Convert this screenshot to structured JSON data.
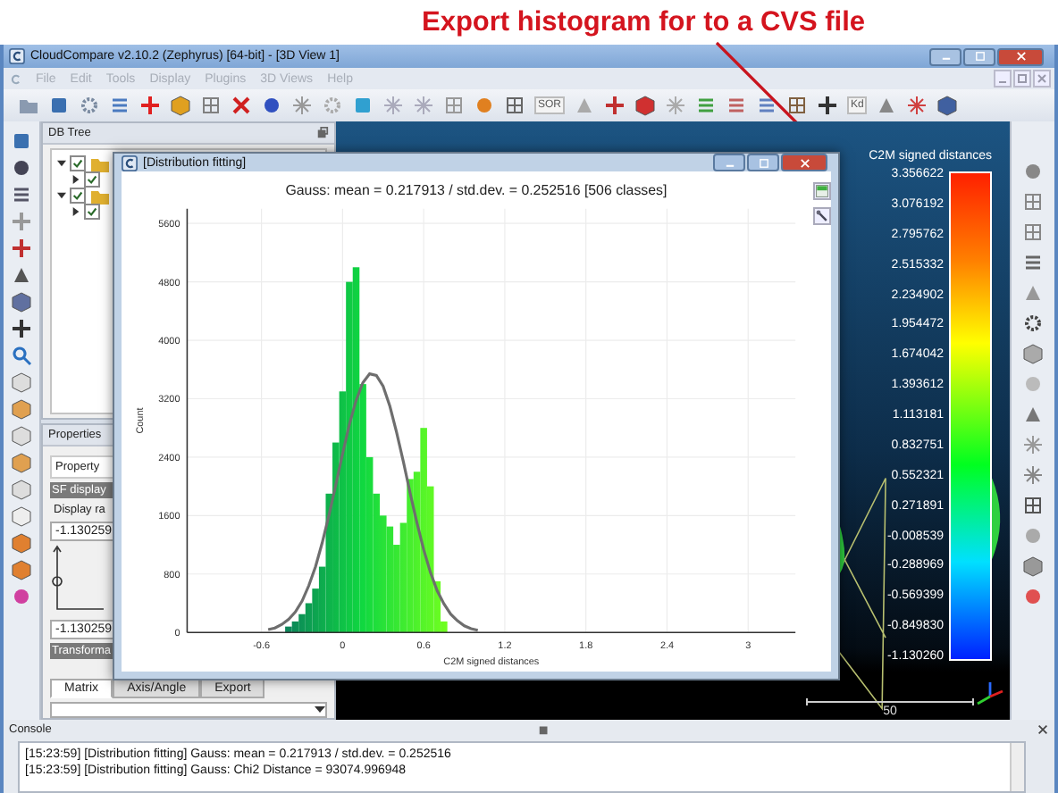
{
  "annotation": {
    "text": "Export histogram for to a CVS file"
  },
  "window": {
    "title": "CloudCompare v2.10.2 (Zephyrus) [64-bit] - [3D View 1]"
  },
  "menu": [
    {
      "label": "File",
      "disabled": true
    },
    {
      "label": "Edit",
      "disabled": true
    },
    {
      "label": "Tools",
      "disabled": true
    },
    {
      "label": "Display",
      "disabled": true
    },
    {
      "label": "Plugins",
      "disabled": true
    },
    {
      "label": "3D Views",
      "disabled": true
    },
    {
      "label": "Help",
      "disabled": true
    }
  ],
  "toolbar": {
    "texts": [
      "SOR",
      "Kd"
    ]
  },
  "db_tree": {
    "title": "DB Tree",
    "items": [
      {
        "checked": true,
        "expanded": true,
        "children": [
          {
            "checked": true,
            "expanded": false
          }
        ]
      },
      {
        "checked": true,
        "expanded": true,
        "children": [
          {
            "checked": true,
            "expanded": false
          }
        ]
      }
    ]
  },
  "properties": {
    "title": "Properties",
    "header": "Property",
    "section": "SF display",
    "row": "Display ra",
    "min_value": "-1.130259",
    "max_value": "-1.130259",
    "section_2": "Transforma",
    "tabs": [
      {
        "label": "Matrix",
        "selected": true
      },
      {
        "label": "Axis/Angle",
        "selected": false
      },
      {
        "label": "Export",
        "selected": false
      }
    ]
  },
  "view": {
    "scale": {
      "title": "C2M signed distances",
      "labels": [
        "3.356622",
        "3.076192",
        "2.795762",
        "2.515332",
        "2.234902",
        "1.954472",
        "1.674042",
        "1.393612",
        "1.113181",
        "0.832751",
        "0.552321",
        "0.271891",
        "-0.008539",
        "-0.288969",
        "-0.569399",
        "-0.849830",
        "-1.130260"
      ]
    },
    "scale_bar": "50"
  },
  "dialog": {
    "title": "[Distribution fitting]",
    "chart_data": {
      "type": "bar",
      "title": "Gauss: mean = 0.217913 / std.dev. = 0.252516 [506 classes]",
      "xlabel": "C2M signed distances",
      "ylabel": "Count",
      "x": [
        -0.55,
        -0.5,
        -0.45,
        -0.4,
        -0.35,
        -0.3,
        -0.25,
        -0.2,
        -0.15,
        -0.1,
        -0.05,
        0,
        0.05,
        0.1,
        0.15,
        0.2,
        0.25,
        0.3,
        0.35,
        0.4,
        0.45,
        0.5,
        0.55,
        0.6,
        0.65,
        0.7,
        0.75,
        0.8,
        0.85,
        0.9,
        0.95,
        1
      ],
      "series": [
        {
          "type": "bar",
          "values": [
            0,
            null,
            null,
            80,
            150,
            250,
            400,
            600,
            900,
            1900,
            2600,
            3300,
            4800,
            5000,
            3400,
            2400,
            1900,
            1600,
            1450,
            1200,
            1500,
            2100,
            2200,
            2800,
            2000,
            700,
            150,
            0,
            0,
            0,
            0,
            0
          ]
        },
        {
          "type": "line",
          "color": "#6e6e6e",
          "values": [
            40,
            60,
            110,
            180,
            280,
            430,
            640,
            900,
            1230,
            1610,
            2020,
            2450,
            2850,
            3180,
            3420,
            3540,
            3520,
            3370,
            3100,
            2740,
            2330,
            1900,
            1500,
            1130,
            820,
            570,
            390,
            250,
            160,
            90,
            50,
            30
          ]
        }
      ],
      "grid": true,
      "xlim": [
        -1.15,
        3.35
      ],
      "ylim": [
        0,
        5800
      ],
      "xticks": [
        -0.6,
        0,
        0.6,
        1.2,
        1.8,
        2.4,
        3
      ],
      "yticks": [
        0,
        800,
        1600,
        2400,
        3200,
        4000,
        4800,
        5600
      ]
    }
  },
  "console": {
    "title": "Console",
    "lines": [
      "[15:23:59] [Distribution fitting] Gauss: mean = 0.217913 / std.dev. = 0.252516",
      "[15:23:59] [Distribution fitting] Gauss: Chi2 Distance = 93074.996948"
    ]
  }
}
